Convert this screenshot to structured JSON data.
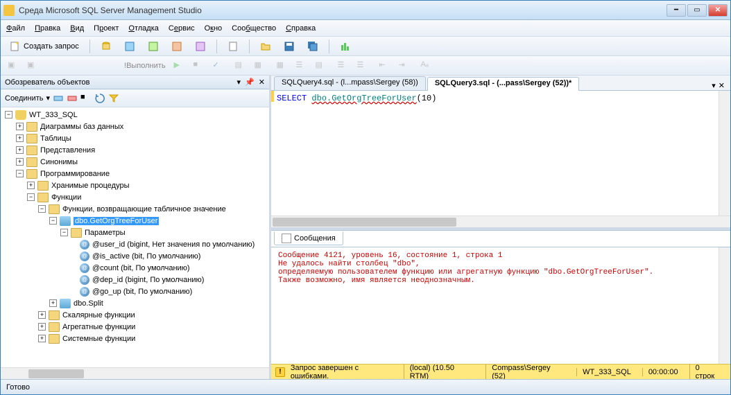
{
  "window": {
    "title": "Среда Microsoft SQL Server Management Studio"
  },
  "menu": {
    "file": "Файл",
    "edit": "Правка",
    "view": "Вид",
    "project": "Проект",
    "debug": "Отладка",
    "service": "Сервис",
    "window": "Окно",
    "community": "Сообщество",
    "help": "Справка"
  },
  "toolbar": {
    "new_query": "Создать запрос",
    "execute": "Выполнить"
  },
  "sidebar": {
    "title": "Обозреватель объектов",
    "connect": "Соединить",
    "tree": {
      "root": "WT_333_SQL",
      "diagrams": "Диаграммы баз данных",
      "tables": "Таблицы",
      "views": "Представления",
      "synonyms": "Синонимы",
      "programming": "Программирование",
      "stored_procs": "Хранимые процедуры",
      "functions": "Функции",
      "table_valued": "Функции, возвращающие табличное значение",
      "selected_fn": "dbo.GetOrgTreeForUser",
      "parameters": "Параметры",
      "params": [
        "@user_id (bigint, Нет значения по умолчанию)",
        "@is_active (bit, По умолчанию)",
        "@count (bit, По умолчанию)",
        "@dep_id (bigint, По умолчанию)",
        "@go_up (bit, По умолчанию)"
      ],
      "dbo_split": "dbo.Split",
      "scalar_fn": "Скалярные функции",
      "aggregate_fn": "Агрегатные функции",
      "system_fn": "Системные функции"
    }
  },
  "editor": {
    "tab1": "SQLQuery4.sql - (l...mpass\\Sergey (58))",
    "tab2": "SQLQuery3.sql - (...pass\\Sergey (52))*",
    "code": {
      "kw": "SELECT ",
      "fn": "dbo.GetOrgTreeForUser",
      "args": "(10)"
    }
  },
  "messages": {
    "tab": "Сообщения",
    "lines": [
      "Сообщение 4121, уровень 16, состояние 1, строка 1",
      "Не удалось найти столбец \"dbo\",",
      "определяемую пользователем функцию или агрегатную функцию \"dbo.GetOrgTreeForUser\".",
      "Также возможно, имя является неоднозначным."
    ]
  },
  "query_status": {
    "text": "Запрос завершен с ошибками.",
    "server": "(local) (10.50 RTM)",
    "user": "Compass\\Sergey (52)",
    "db": "WT_333_SQL",
    "time": "00:00:00",
    "rows": "0 строк"
  },
  "statusbar": {
    "ready": "Готово"
  }
}
